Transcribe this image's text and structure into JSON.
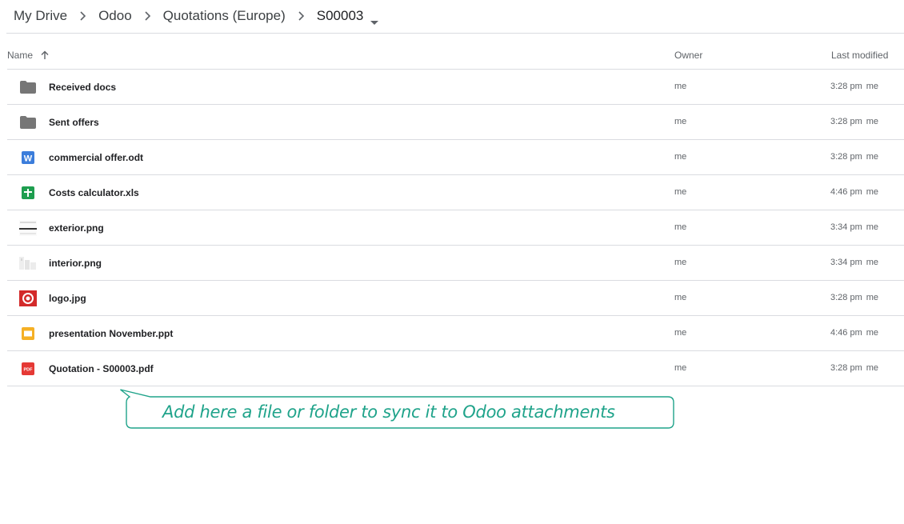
{
  "breadcrumb": {
    "items": [
      "My Drive",
      "Odoo",
      "Quotations (Europe)",
      "S00003"
    ]
  },
  "header": {
    "name_label": "Name",
    "owner_label": "Owner",
    "modified_label": "Last modified",
    "sort_icon": "arrow-up-icon"
  },
  "files": [
    {
      "name": "Received docs",
      "icon": "folder-icon",
      "owner": "me",
      "time": "3:28 pm",
      "by": "me"
    },
    {
      "name": "Sent offers",
      "icon": "folder-icon",
      "owner": "me",
      "time": "3:28 pm",
      "by": "me"
    },
    {
      "name": "commercial offer.odt",
      "icon": "word-doc-icon",
      "owner": "me",
      "time": "3:28 pm",
      "by": "me"
    },
    {
      "name": "Costs calculator.xls",
      "icon": "spreadsheet-icon",
      "owner": "me",
      "time": "4:46 pm",
      "by": "me"
    },
    {
      "name": "exterior.png",
      "icon": "image-thumbnail-icon",
      "owner": "me",
      "time": "3:34 pm",
      "by": "me"
    },
    {
      "name": "interior.png",
      "icon": "image-thumbnail-icon",
      "owner": "me",
      "time": "3:34 pm",
      "by": "me"
    },
    {
      "name": "logo.jpg",
      "icon": "logo-thumbnail-icon",
      "owner": "me",
      "time": "3:28 pm",
      "by": "me"
    },
    {
      "name": "presentation November.ppt",
      "icon": "slides-icon",
      "owner": "me",
      "time": "4:46 pm",
      "by": "me"
    },
    {
      "name": "Quotation - S00003.pdf",
      "icon": "pdf-icon",
      "owner": "me",
      "time": "3:28 pm",
      "by": "me"
    }
  ],
  "callout": {
    "text": "Add here a file or folder to sync it to Odoo attachments",
    "color": "#1fa38a"
  }
}
